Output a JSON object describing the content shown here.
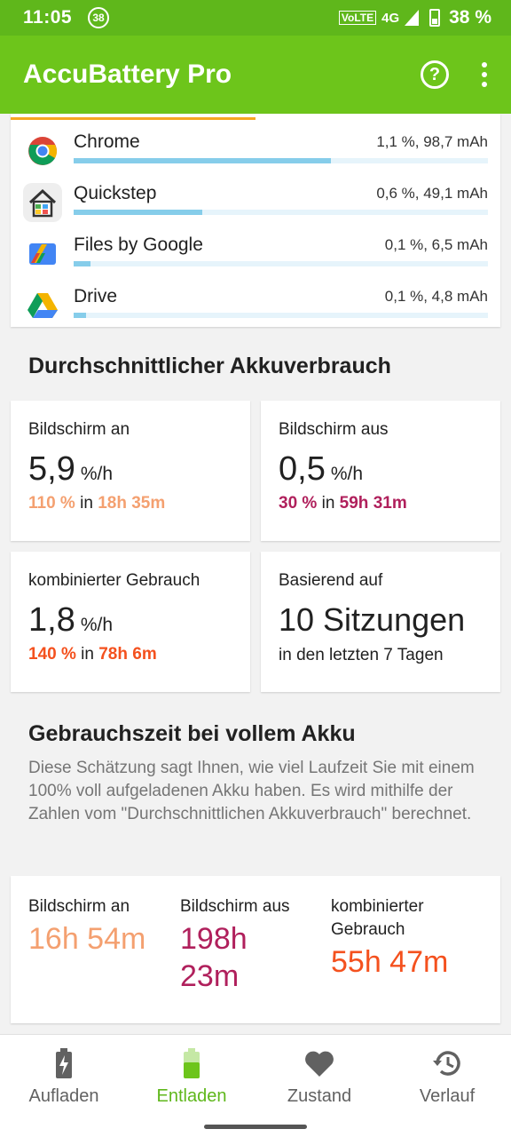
{
  "status_bar": {
    "time": "11:05",
    "notification_count": "38",
    "volte": "VoLTE",
    "network": "4G",
    "battery_percent": "38 %"
  },
  "app_bar": {
    "title": "AccuBattery Pro",
    "help_icon": "help-circle-icon",
    "menu_icon": "more-vert-icon"
  },
  "apps": [
    {
      "name": "Chrome",
      "stat": "1,1 %, 98,7 mAh",
      "fraction": 0.62,
      "icon": "chrome-icon"
    },
    {
      "name": "Quickstep",
      "stat": "0,6 %, 49,1 mAh",
      "fraction": 0.31,
      "icon": "quickstep-icon"
    },
    {
      "name": "Files by Google",
      "stat": "0,1 %, 6,5 mAh",
      "fraction": 0.04,
      "icon": "files-icon"
    },
    {
      "name": "Drive",
      "stat": "0,1 %, 4,8 mAh",
      "fraction": 0.03,
      "icon": "drive-icon"
    }
  ],
  "avg_usage": {
    "title": "Durchschnittlicher Akkuverbrauch",
    "screen_on": {
      "label": "Bildschirm an",
      "value": "5,9",
      "unit": "%/h",
      "pct": "110 %",
      "in": "in",
      "duration": "18h 35m",
      "color": "#f4a070"
    },
    "screen_off": {
      "label": "Bildschirm aus",
      "value": "0,5",
      "unit": "%/h",
      "pct": "30 %",
      "in": "in",
      "duration": "59h 31m",
      "color": "#b0205c"
    },
    "combined": {
      "label": "kombinierter Gebrauch",
      "value": "1,8",
      "unit": "%/h",
      "pct": "140 %",
      "in": "in",
      "duration": "78h 6m",
      "color": "#f4511e"
    },
    "based_on": {
      "label": "Basierend auf",
      "value": "10 Sitzungen",
      "sub": "in den letzten 7 Tagen"
    }
  },
  "full_charge": {
    "title": "Gebrauchszeit bei vollem Akku",
    "description": "Diese Schätzung sagt Ihnen, wie viel Laufzeit Sie mit einem 100% voll aufgeladenen Akku haben. Es wird mithilfe der Zahlen vom \"Durchschnittlichen Akkuverbrauch\" berechnet.",
    "screen_on": {
      "label": "Bildschirm an",
      "value": "16h 54m",
      "color": "#f4a070"
    },
    "screen_off": {
      "label": "Bildschirm aus",
      "value": "198h 23m",
      "color": "#b0205c"
    },
    "combined": {
      "label": "kombinierter Gebrauch",
      "value": "55h 47m",
      "color": "#f4511e"
    }
  },
  "bottom_nav": [
    {
      "label": "Aufladen",
      "icon": "battery-charging-icon",
      "active": false
    },
    {
      "label": "Entladen",
      "icon": "battery-discharging-icon",
      "active": true
    },
    {
      "label": "Zustand",
      "icon": "heart-icon",
      "active": false
    },
    {
      "label": "Verlauf",
      "icon": "history-icon",
      "active": false
    }
  ],
  "colors": {
    "primary": "#6dc51b",
    "status_bar": "#5fb71b",
    "bar_fill": "#86cdea",
    "bar_track": "#e6f4fb",
    "active_nav": "#5fb71b"
  }
}
